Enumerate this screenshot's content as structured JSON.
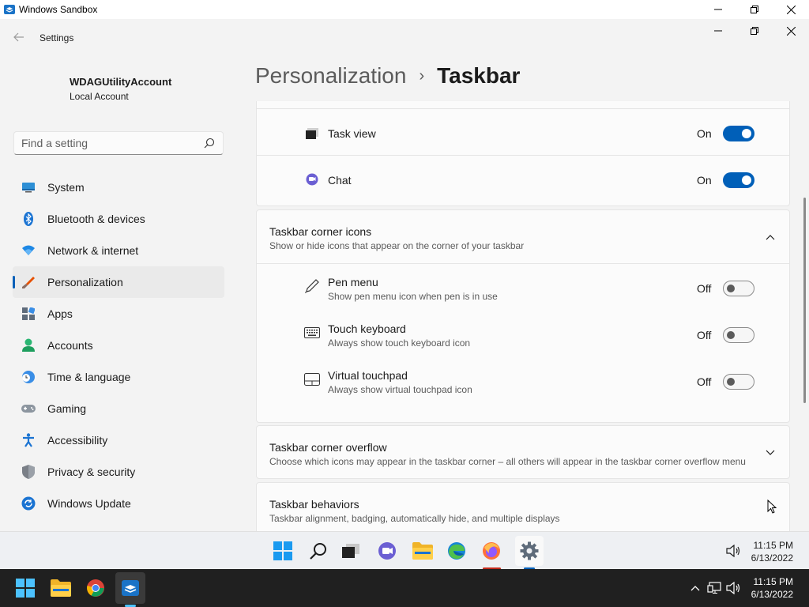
{
  "sandbox": {
    "title": "Windows Sandbox"
  },
  "window": {
    "title": "Settings"
  },
  "account": {
    "name": "WDAGUtilityAccount",
    "type": "Local Account"
  },
  "search": {
    "placeholder": "Find a setting"
  },
  "nav": [
    {
      "label": "System",
      "icon": "monitor-icon"
    },
    {
      "label": "Bluetooth & devices",
      "icon": "bluetooth-icon"
    },
    {
      "label": "Network & internet",
      "icon": "wifi-icon"
    },
    {
      "label": "Personalization",
      "icon": "brush-icon",
      "active": true
    },
    {
      "label": "Apps",
      "icon": "apps-icon"
    },
    {
      "label": "Accounts",
      "icon": "person-icon"
    },
    {
      "label": "Time & language",
      "icon": "clock-globe-icon"
    },
    {
      "label": "Gaming",
      "icon": "gamepad-icon"
    },
    {
      "label": "Accessibility",
      "icon": "accessibility-icon"
    },
    {
      "label": "Privacy & security",
      "icon": "shield-icon"
    },
    {
      "label": "Windows Update",
      "icon": "update-icon"
    }
  ],
  "breadcrumb": {
    "parent": "Personalization",
    "separator": "›",
    "current": "Taskbar"
  },
  "taskbar_items": [
    {
      "label": "Task view",
      "state": "On",
      "on": true
    },
    {
      "label": "Chat",
      "state": "On",
      "on": true
    }
  ],
  "corner_icons": {
    "title": "Taskbar corner icons",
    "subtitle": "Show or hide icons that appear on the corner of your taskbar",
    "items": [
      {
        "label": "Pen menu",
        "sub": "Show pen menu icon when pen is in use",
        "state": "Off",
        "on": false
      },
      {
        "label": "Touch keyboard",
        "sub": "Always show touch keyboard icon",
        "state": "Off",
        "on": false
      },
      {
        "label": "Virtual touchpad",
        "sub": "Always show virtual touchpad icon",
        "state": "Off",
        "on": false
      }
    ]
  },
  "corner_overflow": {
    "title": "Taskbar corner overflow",
    "subtitle": "Choose which icons may appear in the taskbar corner – all others will appear in the taskbar corner overflow menu"
  },
  "behaviors": {
    "title": "Taskbar behaviors",
    "subtitle": "Taskbar alignment, badging, automatically hide, and multiple displays"
  },
  "inner_clock": {
    "time": "11:15 PM",
    "date": "6/13/2022"
  },
  "host_clock": {
    "time": "11:15 PM",
    "date": "6/13/2022"
  },
  "colors": {
    "accent": "#005fb8",
    "background": "#f3f3f3",
    "card": "#fbfbfb"
  }
}
